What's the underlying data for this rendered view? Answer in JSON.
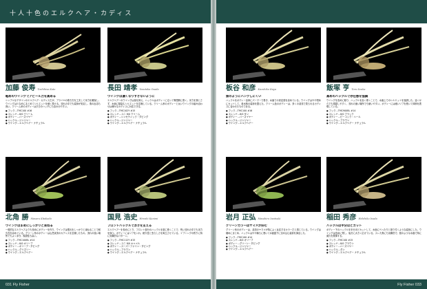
{
  "header": {
    "series_title": "十人十色のエルクヘア・カディス"
  },
  "footer": {
    "left_folio": "031 Fly Fisher",
    "right_folio": "Fly Fisher 033"
  },
  "flies": [
    {
      "name": "加藤 俊寿",
      "romaji": "Toshihisa Kato",
      "subtitle": "軽めのウイングでアピール力を高める",
      "body": "シンプルなデザインのエルクヘア・カディスだが、プライヤの巻き方を工夫して浮力を確保し、ウイングは少なめにまとめてシルエットを細く見せる。流れの中でも姿勢が安定し、魚の反応も良い。クリーム系のボディーは夕方のハッチにも合わせやすい。",
      "recipe": [
        "フック…TMC100 #16",
        "スレッド…8/0 クリーム",
        "ボディー…ハーズイヤー",
        "ハックル…ジンジャー",
        "ウイング…エルクヘアー ナチュラル"
      ]
    },
    {
      "name": "長田 靖孝",
      "romaji": "Yasutaka Osada",
      "subtitle": "ウイングは濃くなりすぎないように",
      "body": "エルクヘアーのウイングは量を抑え、ハックルはボディーに沿って等間隔に巻く。浮力を落とさず、水面に馴染むシルエットを意識している。クリーム系のボディーと淡いウイングの組み合わせは様々なカディスに対応できる。",
      "recipe": [
        "フック…TMC102Y #15",
        "スレッド…ユニ 8/0 クリーム",
        "ボディー…シンセティック・ダビング",
        "ハックル…ジンジャー",
        "ウイング…エルクヘアー ナチュラル"
      ]
    },
    {
      "name": "北角 勝",
      "romaji": "Masaru Kitakado",
      "subtitle": "ウイングはまめにしっかりと束ねる",
      "body": "一般的なエルクヘアよりも長めにボディーを作り、ウイングは根元をしっかりと束ねることで耐久性を高めている。グリーン系のボディーは山岳渓流のカディスを意識したもの。流れの強い場所でもよく浮き、視認性も高い。",
      "recipe": [
        "フック…TMC100BL #14",
        "スレッド…8/0 オリーブ",
        "ボディー…オリーブ・ダビング",
        "ハックル…グリズリー",
        "ウイング…エルクヘアー"
      ]
    },
    {
      "name": "国見 浩史",
      "romaji": "Hiroshi Kunimi",
      "subtitle": "フロントハックルで浮きを支える",
      "body": "エルクヘアーを長めにとり、フロント部分のハックルを密に巻くことで、荒い流れの中でも浮力を保つ。ボディーにはリブを入れ、耐久性と虫らしさを両立させている。イブニングの釣りに特に効果的なパターン。",
      "recipe": [
        "フック…TMC112Y #15",
        "スレッド…ユニ 8/0 キャメル",
        "ボディー…スーパーファイン・ダビング",
        "ハックル…ブラウン",
        "ウイング…エルクヘアー ナチュラル"
      ]
    },
    {
      "name": "板谷 和彦",
      "romaji": "Kazuhiko Itaya",
      "subtitle": "魚のようにハングしにくい",
      "body": "ハックルをボディー全体にパーマーで巻き、水面での安定感を高めている。ウイングはやや短めにカットして、着水時の姿勢を整えた。クリーム色のボディーは、多くの渓流で見られるカディスに合わせたものである。",
      "recipe": [
        "フック…TMC100 #16",
        "スレッド…8/0 タン",
        "ボディー…ハーズイヤー",
        "ハックル…ジンジャー",
        "ウイング…エルクヘアー"
      ]
    },
    {
      "name": "飯塚 亨",
      "romaji": "Toru Iizuka",
      "subtitle": "高めのハックルで存在感を強調",
      "body": "ウイングを長めに取り、ハックルを高く巻くことで、水面上でのシルエットを強調した。遠くからでも視認しやすく、流れの速い場所でも使いやすい。ボディーには細いリブを巻いて体節を表現している。",
      "recipe": [
        "フック…TMC900BL #14",
        "スレッド…8/0 ブラック",
        "ボディー…ピーコック・ハール",
        "ハックル…ブラウン",
        "ウイング…エルクヘアー ナチュラル"
      ]
    },
    {
      "name": "岩月 正弘",
      "romaji": "Masahiro Iwatsuki",
      "subtitle": "グリーンカラーはヤマメが好む",
      "body": "グリーン系のボディーは、渓流のヤマメが特によく反応するカラーだと感じている。ウイングは細めにまとめ、ハックルはやや疎らに巻いて水面直下に沈み込む姿勢を演出した。",
      "recipe": [
        "フック…TMC100 #14",
        "スレッド…8/0 オリーブ",
        "ボディー…グリーン・ダビング",
        "ハックル…ジンジャー",
        "ウイング…エルクヘアー"
      ]
    },
    {
      "name": "稲田 秀彦",
      "romaji": "Hidehiko Inada",
      "subtitle": "ハックルは半分ほどカット",
      "body": "ボディー下のハックルを半分ほどカットして、水面にべったりと張り付くような姿勢にした。ウイングは長めに残し、後方に大きく広げている。スレた魚にも効果的で、鏡のような水面で特に威力を発揮する。",
      "recipe": [
        "フック…TMC100 #15",
        "スレッド…8/0 ブラウン",
        "ボディー…ハーズイヤー",
        "ハックル…ダン",
        "ウイング…エルクヘアー ナチュラル"
      ]
    }
  ]
}
